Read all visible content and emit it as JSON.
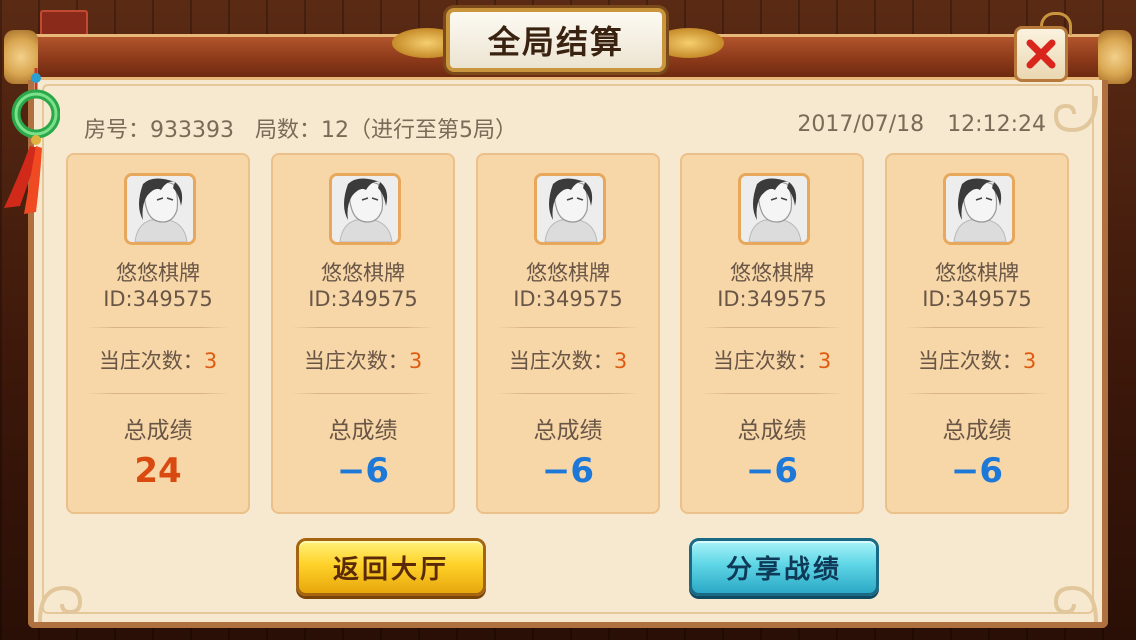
{
  "title": "全局结算",
  "room": {
    "room_label": "房号：933393",
    "rounds_label": "局数：12（进行至第5局）",
    "date": "2017/07/18",
    "time": "12:12:24"
  },
  "players": [
    {
      "name": "悠悠棋牌",
      "id": "ID:349575",
      "banker_label": "当庄次数：",
      "banker_count": "3",
      "total_label": "总成绩",
      "total_score": "24",
      "positive": true
    },
    {
      "name": "悠悠棋牌",
      "id": "ID:349575",
      "banker_label": "当庄次数：",
      "banker_count": "3",
      "total_label": "总成绩",
      "total_score": "−6",
      "positive": false
    },
    {
      "name": "悠悠棋牌",
      "id": "ID:349575",
      "banker_label": "当庄次数：",
      "banker_count": "3",
      "total_label": "总成绩",
      "total_score": "−6",
      "positive": false
    },
    {
      "name": "悠悠棋牌",
      "id": "ID:349575",
      "banker_label": "当庄次数：",
      "banker_count": "3",
      "total_label": "总成绩",
      "total_score": "−6",
      "positive": false
    },
    {
      "name": "悠悠棋牌",
      "id": "ID:349575",
      "banker_label": "当庄次数：",
      "banker_count": "3",
      "total_label": "总成绩",
      "total_score": "−6",
      "positive": false
    }
  ],
  "buttons": {
    "back_label": "返回大厅",
    "share_label": "分享战绩"
  },
  "colors": {
    "positive_score": "#d84a10",
    "negative_score": "#1e78d8",
    "banker_count": "#e05a12",
    "card_bg": "#f7d7a8",
    "panel_bg": "#f7e9cf"
  },
  "icons": {
    "close": "close-x-icon",
    "avatar": "avatar-portrait-icon",
    "ornament": "tassel-ornament-icon"
  }
}
